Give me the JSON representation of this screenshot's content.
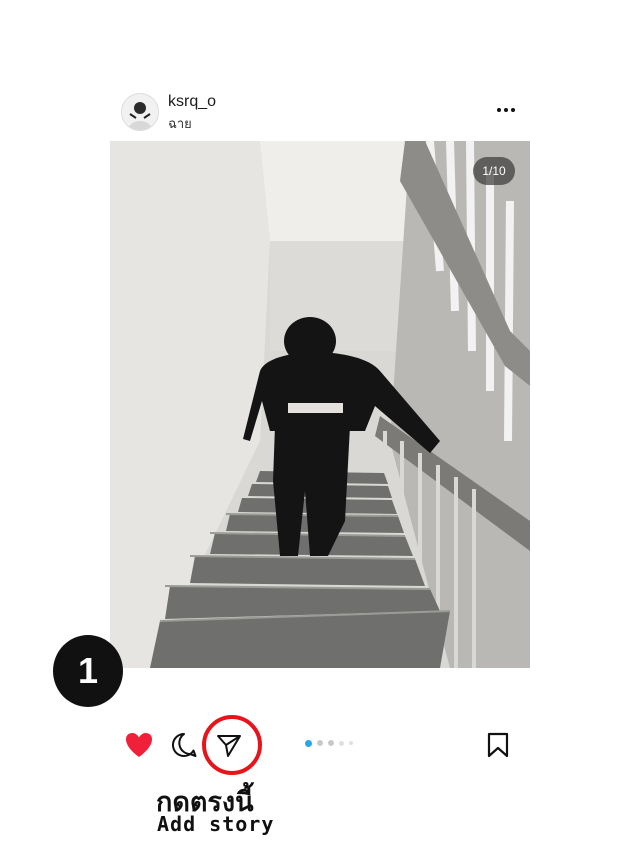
{
  "post": {
    "username": "ksrq_o",
    "location": "ฉาย",
    "more_icon": "more-horizontal-icon",
    "image_counter": "1/10",
    "carousel": {
      "total_dots": 5,
      "active_index": 0
    }
  },
  "actions": {
    "like_icon": "heart-filled-icon",
    "comment_icon": "comment-icon",
    "share_icon": "send-icon",
    "save_icon": "bookmark-icon"
  },
  "annotation": {
    "step_number": "1",
    "caption_thai": "กดตรงนี้",
    "caption_english": "Add story",
    "highlight_color": "#e6151b"
  },
  "colors": {
    "like": "#f0203a",
    "dot_active": "#2aa6e8",
    "dot_inactive": "#c9c9c9"
  }
}
